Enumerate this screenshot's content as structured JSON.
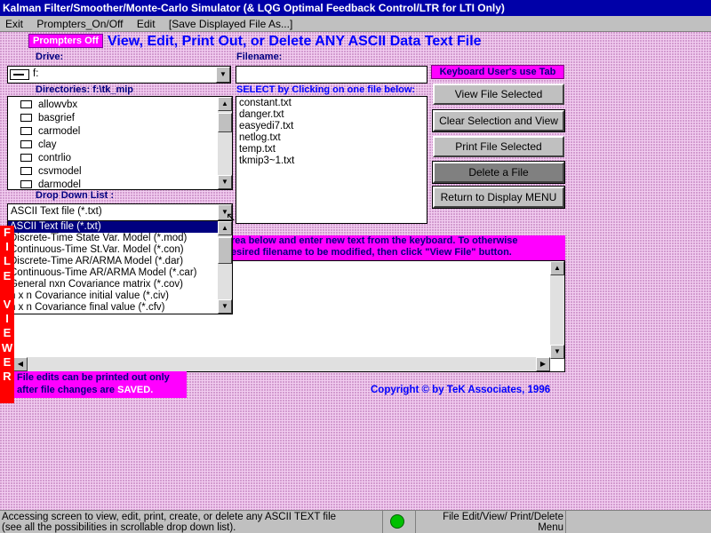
{
  "window": {
    "title": "Kalman Filter/Smoother/Monte-Carlo Simulator (& LQG Optimal Feedback Control/LTR for LTI Only)"
  },
  "menu": {
    "items": [
      "Exit",
      "Prompters_On/Off",
      "Edit",
      "[Save Displayed File As...]"
    ]
  },
  "header": {
    "prompters_button": "Prompters Off",
    "headline": "View, Edit, Print Out, or Delete ANY ASCII Data Text File"
  },
  "drive": {
    "label": "Drive:",
    "value": "f:"
  },
  "directories": {
    "label": "Directories: f:\\tk_mip",
    "items": [
      "allowvbx",
      "basgrief",
      "carmodel",
      "clay",
      "contrlio",
      "csvmodel",
      "darmodel"
    ]
  },
  "filename": {
    "label": "Filename:",
    "value": "",
    "select_label": "SELECT by Clicking on one file below:",
    "files": [
      "constant.txt",
      "danger.txt",
      "easyedi7.txt",
      "netlog.txt",
      "temp.txt",
      "tkmip3~1.txt"
    ]
  },
  "keyboard_tip": "Keyboard User's use Tab",
  "buttons": {
    "view": "View File Selected",
    "clear": "Clear Selection and View",
    "print": "Print File Selected",
    "delete": "Delete a File",
    "return": "Return to Display MENU"
  },
  "dropdown": {
    "label": "Drop Down List :",
    "selected": "ASCII Text file (*.txt)",
    "options": [
      "ASCII Text file (*.txt)",
      "Discrete-Time State Var. Model (*.mod)",
      "Continuous-Time St.Var. Model (*.con)",
      "Discrete-Time AR/ARMA Model (*.dar)",
      "Continuous-Time AR/ARMA Model (*.car)",
      "General nxn Covariance matrix (*.cov)",
      "n x n Covariance initial value (*.civ)",
      "n x n Covariance final value (*.cfv)"
    ]
  },
  "viewer": {
    "strip_letters": [
      "F",
      "I",
      "L",
      "E",
      " ",
      "V",
      "I",
      "E",
      "W",
      "E",
      "R"
    ],
    "instructions_line1": "rea below and enter new text from the keyboard. To otherwise",
    "instructions_line2": "esired filename to be modified, then click \"View File\" button."
  },
  "notes": {
    "edits_line1": "File edits can be printed out only",
    "edits_line2_prefix": "after  file changes are",
    "edits_saved": "SAVED.",
    "copyright": "Copyright © by TeK Associates, 1996"
  },
  "status": {
    "left_line1": "Accessing screen to view, edit, print, create, or delete any ASCII TEXT file",
    "left_line2": "(see all the possibilities in scrollable drop down list).",
    "right_line1": "File Edit/View/ Print/Delete",
    "right_line2": "Menu",
    "indicator_color": "#00c000"
  }
}
